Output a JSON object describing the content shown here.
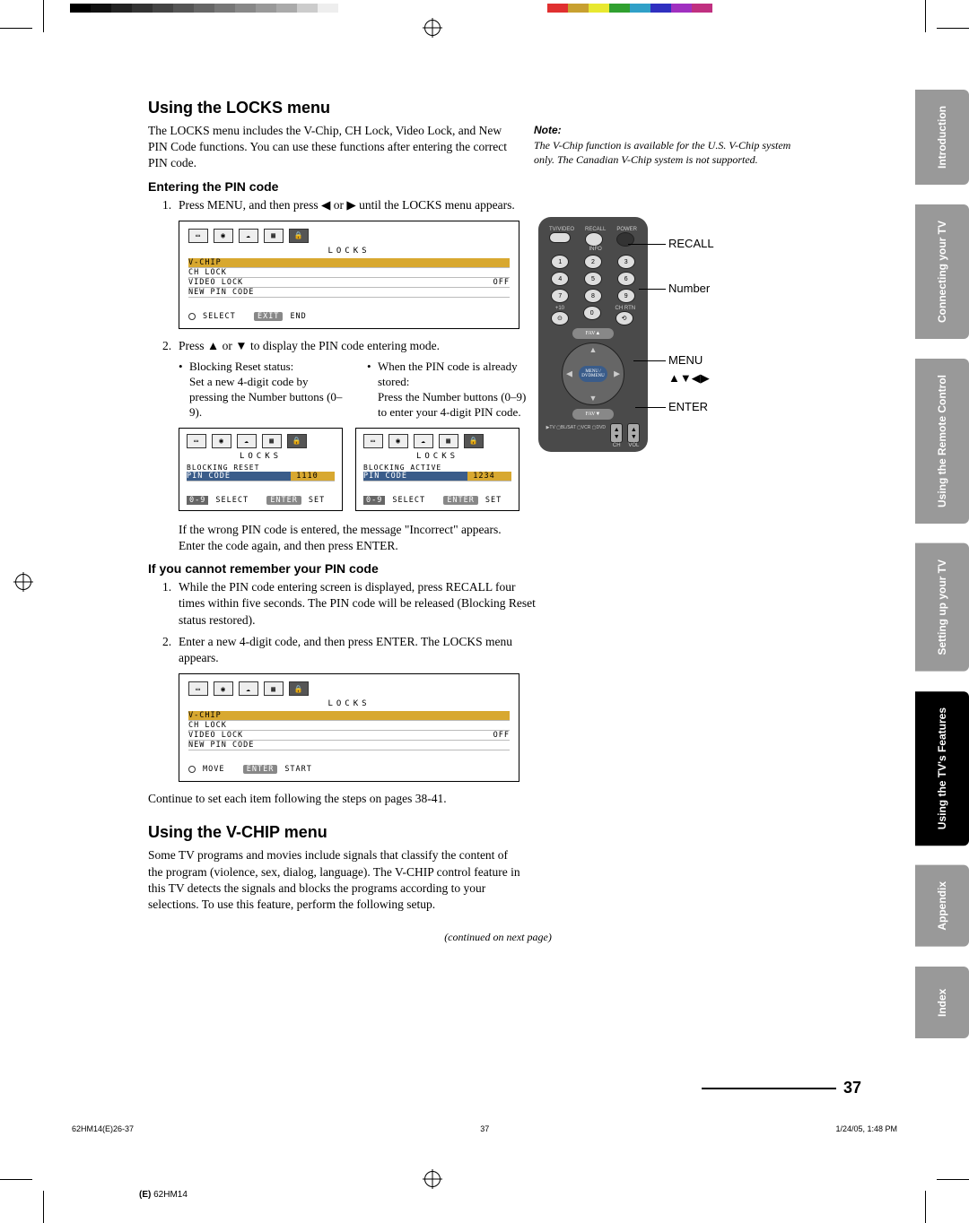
{
  "colorbar_left": [
    "#000",
    "#111",
    "#222",
    "#333",
    "#444",
    "#555",
    "#666",
    "#777",
    "#888",
    "#999",
    "#aaa",
    "#ccc",
    "#eee",
    "#fff"
  ],
  "colorbar_right": [
    "#e03030",
    "#c8a030",
    "#e8e830",
    "#30a030",
    "#30a0c8",
    "#3030c0",
    "#a030c0",
    "#c03080"
  ],
  "sidebar": {
    "items": [
      {
        "label": "Introduction"
      },
      {
        "label": "Connecting\nyour TV"
      },
      {
        "label": "Using the\nRemote Control"
      },
      {
        "label": "Setting up\nyour TV"
      },
      {
        "label": "Using the TV's\nFeatures"
      },
      {
        "label": "Appendix"
      },
      {
        "label": "Index"
      }
    ],
    "active_index": 4
  },
  "note": {
    "heading": "Note:",
    "body": "The V-Chip function is available for the U.S. V-Chip system only. The Canadian V-Chip system is not supported."
  },
  "remote_callouts": {
    "recall": "RECALL",
    "number": "Number",
    "menu": "MENU",
    "arrows": "▲▼◀▶",
    "enter": "ENTER"
  },
  "remote_labels": {
    "tvvideo": "TV/VIDEO",
    "recall": "RECALL",
    "power": "POWER",
    "info": "INFO",
    "chrtn": "CH RTN",
    "plus10": "+10",
    "favup": "FAV▲",
    "favdn": "FAV▼",
    "menu": "MENU / DVDMENU",
    "sel": "▶TV\n▢BL/SAT\n▢VCR\n▢DVD",
    "ch": "CH",
    "vol": "VOL"
  },
  "section1": {
    "heading": "Using the LOCKS menu",
    "intro": "The LOCKS menu includes the V-Chip, CH Lock, Video Lock, and New PIN Code functions. You can use these functions after entering the correct PIN code.",
    "sub1": "Entering the PIN code",
    "step1_num": "1.",
    "step1": "Press MENU, and then press ◀ or ▶ until the LOCKS menu appears.",
    "osd1": {
      "title": "LOCKS",
      "rows": [
        [
          "V-CHIP",
          ""
        ],
        [
          "CH  LOCK",
          ""
        ],
        [
          "VIDEO  LOCK",
          "OFF"
        ],
        [
          "NEW  PIN  CODE",
          ""
        ]
      ],
      "highlight": 0,
      "foot_select": "SELECT",
      "foot_exit": "EXIT",
      "foot_end": "END"
    },
    "step2_num": "2.",
    "step2": "Press ▲ or ▼ to display the PIN code entering mode.",
    "bullet_left_head": "Blocking Reset status:",
    "bullet_left_body": "Set a new 4-digit code by pressing the Number buttons (0–9).",
    "bullet_right_head": "When the PIN code is already stored:",
    "bullet_right_body": "Press the Number buttons (0–9) to enter your 4-digit PIN code.",
    "osd2a": {
      "title": "LOCKS",
      "status": "BLOCKING  RESET",
      "row": "PIN  CODE",
      "val": "1110",
      "foot_select": "SELECT",
      "foot_enter": "ENTER",
      "foot_set": "SET"
    },
    "osd2b": {
      "title": "LOCKS",
      "status": "BLOCKING  ACTIVE",
      "row": "PIN  CODE",
      "val": "1234",
      "foot_select": "SELECT",
      "foot_enter": "ENTER",
      "foot_set": "SET"
    },
    "if_wrong": "If the wrong PIN code is entered, the message \"Incorrect\" appears. Enter the code again, and then press ENTER.",
    "sub2": "If you cannot remember your PIN code",
    "step_r1_num": "1.",
    "step_r1": "While the PIN code entering screen is displayed, press RECALL four times within five seconds. The PIN code will be released (Blocking Reset status restored).",
    "step_r2_num": "2.",
    "step_r2": "Enter a new 4-digit code, and then press ENTER. The LOCKS menu appears.",
    "osd3": {
      "title": "LOCKS",
      "rows": [
        [
          "V-CHIP",
          ""
        ],
        [
          "CH  LOCK",
          ""
        ],
        [
          "VIDEO  LOCK",
          "OFF"
        ],
        [
          "NEW  PIN  CODE",
          ""
        ]
      ],
      "highlight": 0,
      "foot_move": "MOVE",
      "foot_enter": "ENTER",
      "foot_start": "START"
    },
    "continue": "Continue to set each item following the steps on pages 38-41."
  },
  "section2": {
    "heading": "Using the V-CHIP menu",
    "intro": "Some TV programs and movies include signals that classify the content of the program (violence, sex, dialog, language). The V-CHIP control feature in this TV detects the signals and blocks the programs according to your selections. To use this feature, perform the following setup.",
    "continued": "(continued on next page)"
  },
  "page_number": "37",
  "footer": {
    "file": "62HM14(E)26-37",
    "pg": "37",
    "time": "1/24/05, 1:48 PM"
  },
  "bottom_code": "(E) 62HM14"
}
